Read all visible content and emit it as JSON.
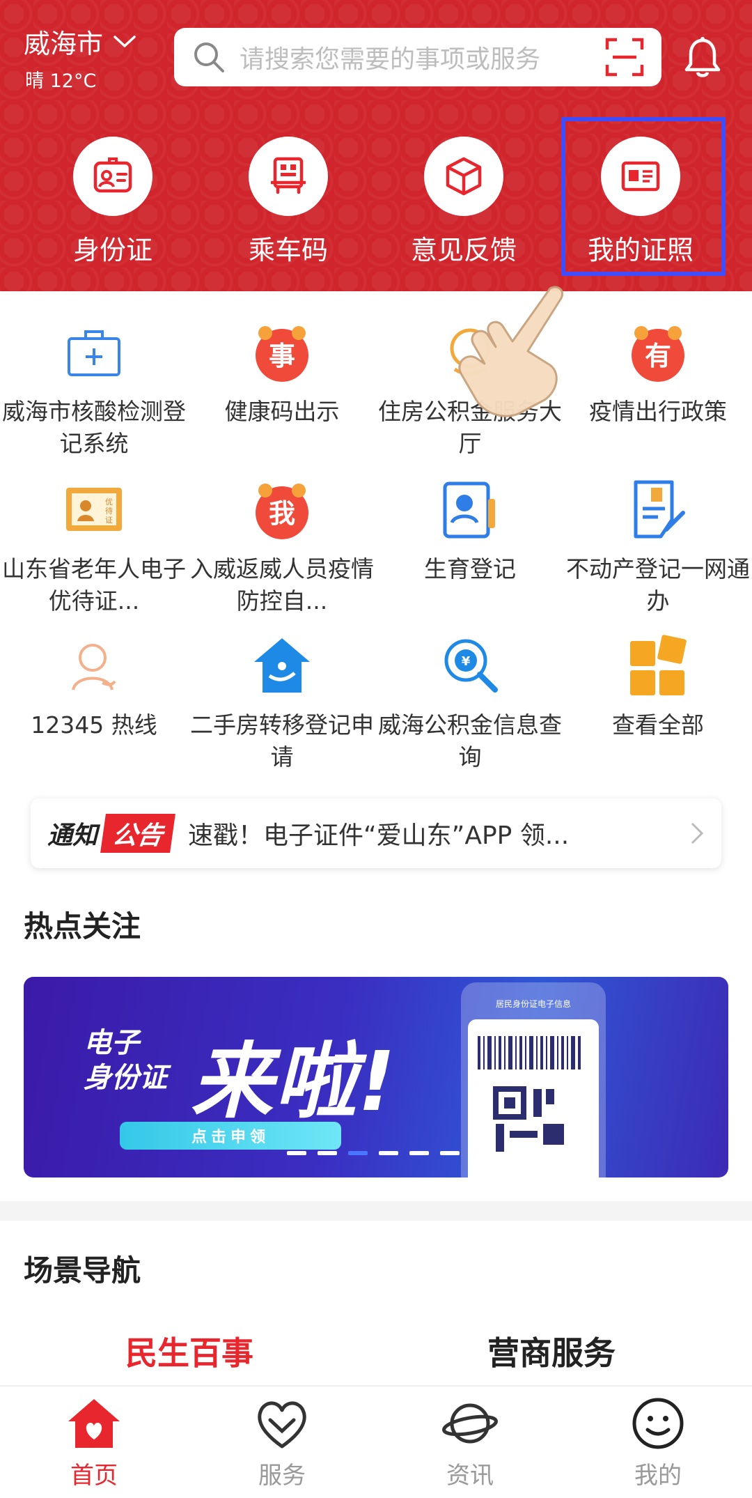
{
  "header": {
    "city": "威海市",
    "weather": "晴 12°C",
    "search_placeholder": "请搜索您需要的事项或服务"
  },
  "quick_access": [
    {
      "label": "身份证",
      "icon": "id-card-icon"
    },
    {
      "label": "乘车码",
      "icon": "bus-code-icon"
    },
    {
      "label": "意见反馈",
      "icon": "feedback-box-icon"
    },
    {
      "label": "我的证照",
      "icon": "license-card-icon",
      "highlighted": true
    }
  ],
  "services": [
    {
      "label": "威海市核酸检测登记系统",
      "icon": "medical-kit-icon"
    },
    {
      "label": "健康码出示",
      "icon": "badge-shi-icon"
    },
    {
      "label": "住房公积金服务大厅",
      "icon": "housing-fund-icon"
    },
    {
      "label": "疫情出行政策",
      "icon": "badge-you-icon"
    },
    {
      "label": "山东省老年人电子优待证...",
      "icon": "elder-card-icon"
    },
    {
      "label": "入威返威人员疫情防控自...",
      "icon": "badge-wo-icon"
    },
    {
      "label": "生育登记",
      "icon": "birth-registration-icon"
    },
    {
      "label": "不动产登记一网通办",
      "icon": "property-document-icon"
    },
    {
      "label": "12345 热线",
      "icon": "hotline-person-icon"
    },
    {
      "label": "二手房转移登记申请",
      "icon": "house-transfer-icon"
    },
    {
      "label": "威海公积金信息查询",
      "icon": "fund-query-icon"
    },
    {
      "label": "查看全部",
      "icon": "all-grid-icon"
    }
  ],
  "notice": {
    "tag_1": "通知",
    "tag_2": "公告",
    "text": "速戳！电子证件“爱山东”APP 领..."
  },
  "hot_title": "热点关注",
  "banner": {
    "small_text": "电子\n身份证",
    "big_text": "来啦!",
    "button": "点击申领",
    "phone_title": "居民身份证电子信息"
  },
  "scene_title": "场景导航",
  "scene_tabs": [
    "民生百事",
    "营商服务"
  ],
  "bottom_nav": [
    {
      "label": "首页",
      "icon": "home-icon",
      "active": true
    },
    {
      "label": "服务",
      "icon": "heart-service-icon",
      "active": false
    },
    {
      "label": "资讯",
      "icon": "planet-icon",
      "active": false
    },
    {
      "label": "我的",
      "icon": "smiley-icon",
      "active": false
    }
  ],
  "colors": {
    "brand_red": "#d0252c",
    "highlight_blue": "#3d4dff"
  }
}
